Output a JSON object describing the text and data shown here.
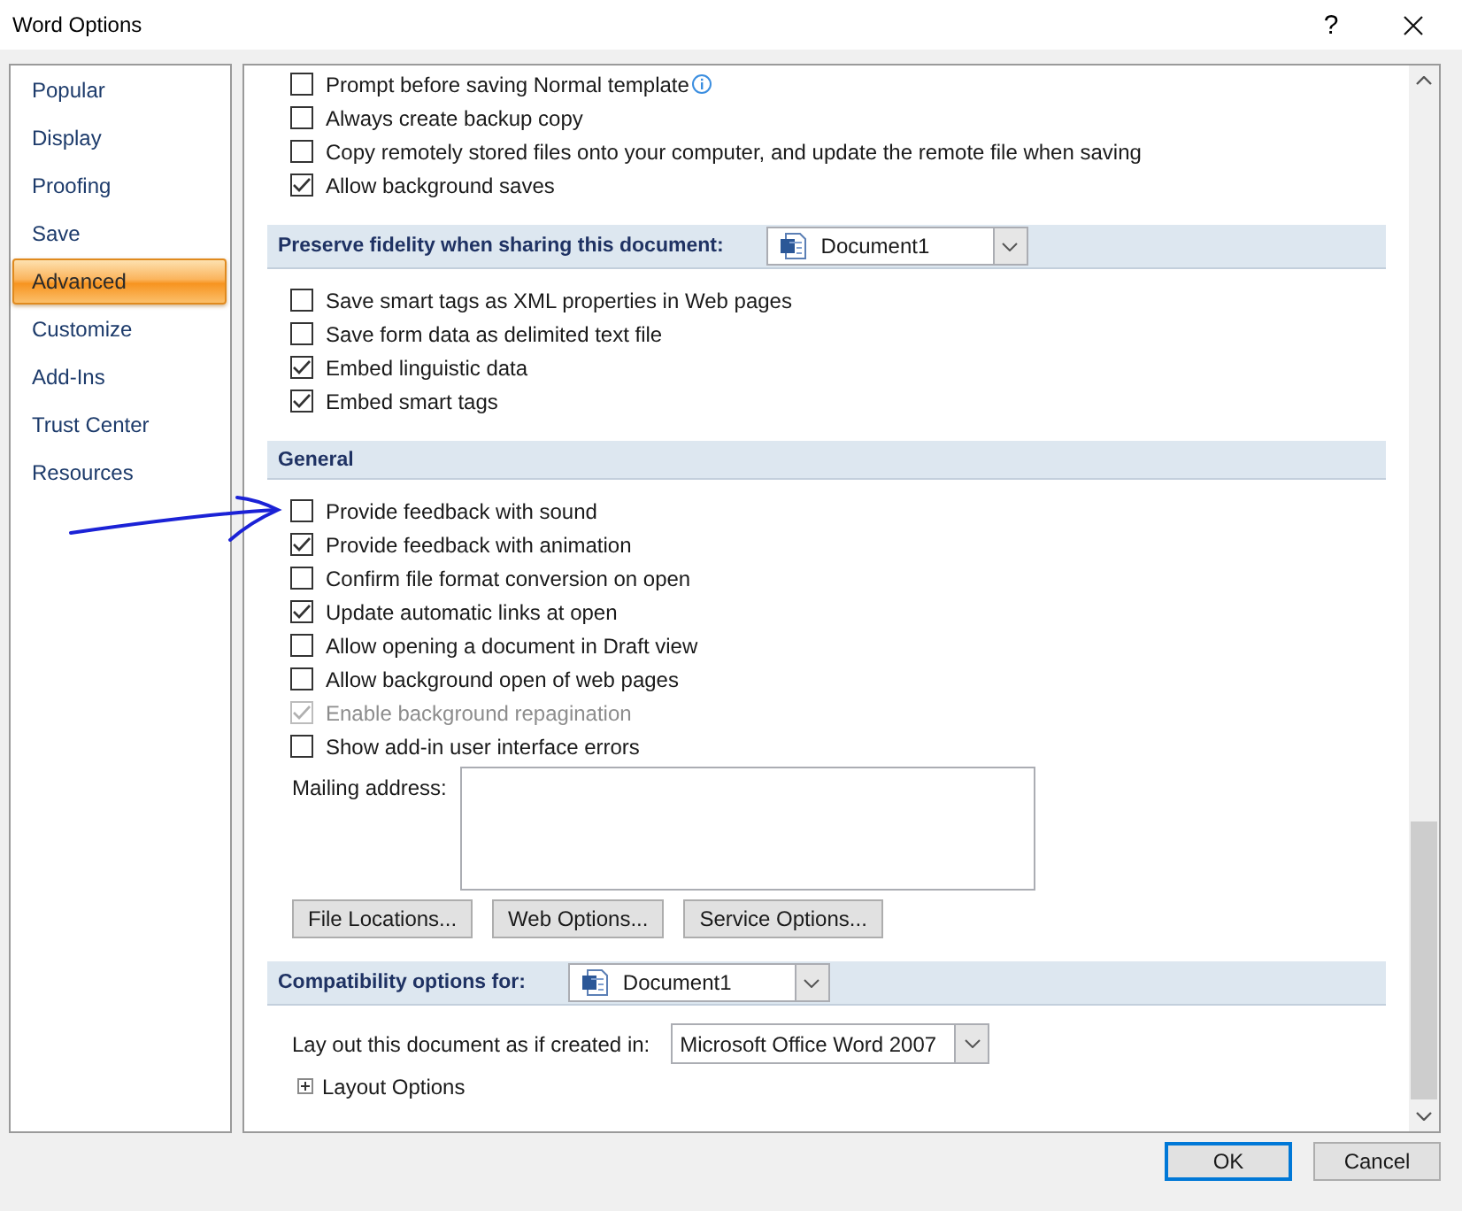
{
  "window": {
    "title": "Word Options",
    "help": "?"
  },
  "sidebar": {
    "items": [
      {
        "label": "Popular",
        "selected": false
      },
      {
        "label": "Display",
        "selected": false
      },
      {
        "label": "Proofing",
        "selected": false
      },
      {
        "label": "Save",
        "selected": false
      },
      {
        "label": "Advanced",
        "selected": true
      },
      {
        "label": "Customize",
        "selected": false
      },
      {
        "label": "Add-Ins",
        "selected": false
      },
      {
        "label": "Trust Center",
        "selected": false
      },
      {
        "label": "Resources",
        "selected": false
      }
    ]
  },
  "panel": {
    "items": [
      {
        "kind": "checkbox",
        "label": "Prompt before saving Normal template",
        "checked": false,
        "disabled": false,
        "info": true
      },
      {
        "kind": "checkbox",
        "label": "Always create backup copy",
        "checked": false,
        "disabled": false
      },
      {
        "kind": "checkbox",
        "label": "Copy remotely stored files onto your computer, and update the remote file when saving",
        "checked": false,
        "disabled": false
      },
      {
        "kind": "checkbox",
        "label": "Allow background saves",
        "checked": true,
        "disabled": false
      },
      {
        "kind": "header",
        "label": "Preserve fidelity when sharing this document:",
        "dropdown": "Document1"
      },
      {
        "kind": "checkbox",
        "label": "Save smart tags as XML properties in Web pages",
        "checked": false,
        "disabled": false
      },
      {
        "kind": "checkbox",
        "label": "Save form data as delimited text file",
        "checked": false,
        "disabled": false
      },
      {
        "kind": "checkbox",
        "label": "Embed linguistic data",
        "checked": true,
        "disabled": false
      },
      {
        "kind": "checkbox",
        "label": "Embed smart tags",
        "checked": true,
        "disabled": false
      },
      {
        "kind": "header",
        "label": "General"
      },
      {
        "kind": "checkbox",
        "label": "Provide feedback with sound",
        "checked": false,
        "disabled": false
      },
      {
        "kind": "checkbox",
        "label": "Provide feedback with animation",
        "checked": true,
        "disabled": false
      },
      {
        "kind": "checkbox",
        "label": "Confirm file format conversion on open",
        "checked": false,
        "disabled": false
      },
      {
        "kind": "checkbox",
        "label": "Update automatic links at open",
        "checked": true,
        "disabled": false
      },
      {
        "kind": "checkbox",
        "label": "Allow opening a document in Draft view",
        "checked": false,
        "disabled": false
      },
      {
        "kind": "checkbox",
        "label": "Allow background open of web pages",
        "checked": false,
        "disabled": false
      },
      {
        "kind": "checkbox",
        "label": "Enable background repagination",
        "checked": true,
        "disabled": true
      },
      {
        "kind": "checkbox",
        "label": "Show add-in user interface errors",
        "checked": false,
        "disabled": false
      },
      {
        "kind": "textarea",
        "label": "Mailing address:"
      },
      {
        "kind": "buttons",
        "buttons": [
          "File Locations...",
          "Web Options...",
          "Service Options..."
        ]
      },
      {
        "kind": "header",
        "label": "Compatibility options for:",
        "dropdown": "Document1"
      },
      {
        "kind": "select",
        "label": "Lay out this document as if created in:",
        "value": "Microsoft Office Word 2007"
      },
      {
        "kind": "expander",
        "label": "Layout Options",
        "expanded": false
      }
    ]
  },
  "footer": {
    "buttons": [
      {
        "label": "OK",
        "default": true
      },
      {
        "label": "Cancel",
        "default": false
      }
    ]
  }
}
